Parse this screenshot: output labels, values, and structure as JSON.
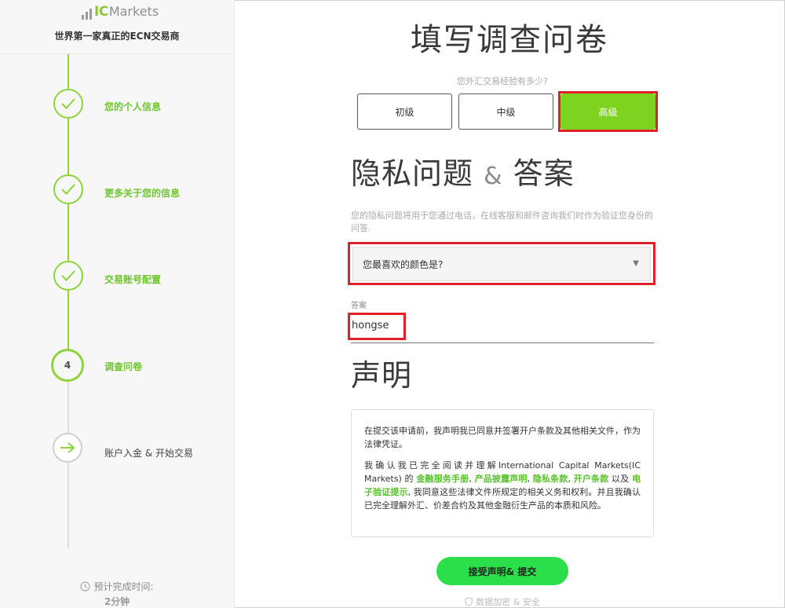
{
  "brand": {
    "logo_ic": "IC",
    "logo_markets": "Markets",
    "tagline": "世界第一家真正的ECN交易商",
    "accent_color": "#7ed321"
  },
  "sidebar": {
    "steps": [
      {
        "label": "您的个人信息",
        "status": "done",
        "icon": "checkmark-icon"
      },
      {
        "label": "更多关于您的信息",
        "status": "done",
        "icon": "checkmark-icon"
      },
      {
        "label": "交易账号配置",
        "status": "done",
        "icon": "checkmark-icon"
      },
      {
        "label": "调查问卷",
        "status": "current",
        "number": "4"
      },
      {
        "label": "账户入金 & 开始交易",
        "status": "todo",
        "icon": "arrow-right-icon"
      }
    ],
    "eta_label": "预计完成时间:",
    "eta_value": "2分钟"
  },
  "main": {
    "title": "填写调查问卷",
    "experience": {
      "question": "您外汇交易经验有多少?",
      "options": [
        "初级",
        "中级",
        "高级"
      ],
      "selected": "高级"
    },
    "security": {
      "title_part1": "隐私问题",
      "title_amp": "&",
      "title_part2": "答案",
      "description": "您的隐私问题将用于您通过电话，在线客服和邮件咨询我们时作为验证您身份的问答.",
      "question_selected": "您最喜欢的颜色是?",
      "answer_label": "答案",
      "answer_value": "hongse"
    },
    "declaration": {
      "title": "声明",
      "paragraph1": "在提交该申请前，我声明我已同意并签署开户条款及其他相关文件，作为法律凭证。",
      "p2_a": "我确认我已完全阅读并理解International Capital Markets(IC Markets) 的 ",
      "link1": "金融服务手册",
      "sep1": ", ",
      "link2": "产品披露声明",
      "sep2": ", ",
      "link3": "隐私条款",
      "sep3": ", ",
      "link4": "开户条款",
      "p2_b": " 以及 ",
      "link5": "电子验证提示",
      "p2_c": ", 我同意这些法律文件所规定的相关义务和权利。并且我确认已完全理解外汇、价差合约及其他金融衍生产品的本质和风险。"
    },
    "submit_label": "接受声明& 提交",
    "secure_note": "数据加密 & 安全",
    "highlight_color": "#e0202a"
  }
}
